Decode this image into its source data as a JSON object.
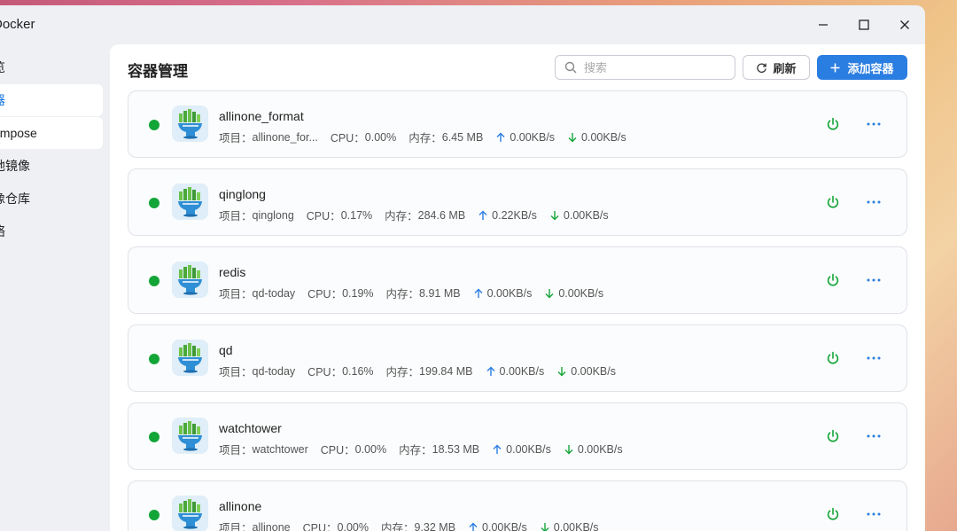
{
  "window": {
    "title": "Docker"
  },
  "sidebar": {
    "items": [
      {
        "label": "览"
      },
      {
        "label": "器"
      },
      {
        "label": "ompose"
      },
      {
        "label": "地镜像"
      },
      {
        "label": "像仓库"
      },
      {
        "label": "络"
      }
    ]
  },
  "main": {
    "title": "容器管理",
    "search_placeholder": "搜索",
    "refresh_label": "刷新",
    "add_label": "添加容器"
  },
  "labels": {
    "project": "项目：",
    "cpu": "CPU：",
    "mem": "内存："
  },
  "colors": {
    "accent": "#2a7de1",
    "running": "#13a538"
  },
  "containers": [
    {
      "name": "allinone_format",
      "project": "allinone_for...",
      "cpu": "0.00%",
      "mem": "6.45 MB",
      "up": "0.00KB/s",
      "down": "0.00KB/s",
      "status": "running"
    },
    {
      "name": "qinglong",
      "project": "qinglong",
      "cpu": "0.17%",
      "mem": "284.6 MB",
      "up": "0.22KB/s",
      "down": "0.00KB/s",
      "status": "running"
    },
    {
      "name": "redis",
      "project": "qd-today",
      "cpu": "0.19%",
      "mem": "8.91 MB",
      "up": "0.00KB/s",
      "down": "0.00KB/s",
      "status": "running"
    },
    {
      "name": "qd",
      "project": "qd-today",
      "cpu": "0.16%",
      "mem": "199.84 MB",
      "up": "0.00KB/s",
      "down": "0.00KB/s",
      "status": "running"
    },
    {
      "name": "watchtower",
      "project": "watchtower",
      "cpu": "0.00%",
      "mem": "18.53 MB",
      "up": "0.00KB/s",
      "down": "0.00KB/s",
      "status": "running"
    },
    {
      "name": "allinone",
      "project": "allinone",
      "cpu": "0.00%",
      "mem": "9.32 MB",
      "up": "0.00KB/s",
      "down": "0.00KB/s",
      "status": "running"
    }
  ]
}
